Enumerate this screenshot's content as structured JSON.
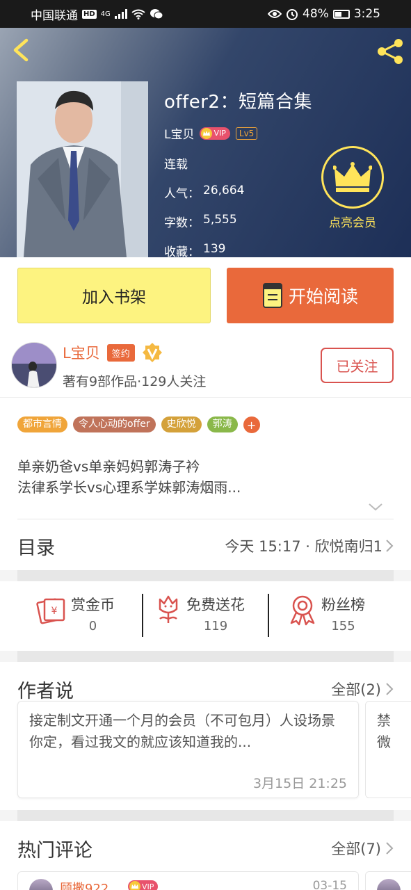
{
  "status_bar": {
    "carrier": "中国联通",
    "hd": "HD",
    "network": "4G",
    "battery": "48%",
    "time": "3:25"
  },
  "book": {
    "title": "offer2：短篇合集",
    "author": "L宝贝",
    "vip_label": "VIP",
    "level": "Lv5",
    "status": "连载",
    "stats": [
      {
        "label": "人气：",
        "value": "26,664"
      },
      {
        "label": "字数：",
        "value": "5,555"
      },
      {
        "label": "收藏：",
        "value": "139"
      }
    ],
    "member_label": "点亮会员"
  },
  "actions": {
    "add_shelf": "加入书架",
    "start_read": "开始阅读"
  },
  "author_card": {
    "name": "L宝贝",
    "sign_label": "签约",
    "summary": "著有9部作品·129人关注",
    "follow_label": "已关注"
  },
  "tags": [
    {
      "label": "都市言情",
      "color": "#f0a53a"
    },
    {
      "label": "令人心动的offer",
      "color": "#c0735a"
    },
    {
      "label": "史欣悦",
      "color": "#d4a13a"
    },
    {
      "label": "郭涛",
      "color": "#8ab84a"
    }
  ],
  "tag_more": "+",
  "intro": {
    "line1": "单亲奶爸vs单亲妈妈郭涛子衿",
    "line2": "法律系学长vs心理系学妹郭涛烟雨..."
  },
  "catalog": {
    "title": "目录",
    "latest": "今天 15:17 · 欣悦南归1"
  },
  "gifts": [
    {
      "label": "赏金币",
      "value": "0",
      "icon": "coin-icon"
    },
    {
      "label": "免费送花",
      "value": "119",
      "icon": "flower-icon"
    },
    {
      "label": "粉丝榜",
      "value": "155",
      "icon": "medal-icon"
    }
  ],
  "author_says": {
    "title": "作者说",
    "more": "全部(2)",
    "card_text": "接定制文开通一个月的会员（不可包月）人设场景你定，看过我文的就应该知道我的...",
    "card_time": "3月15日  21:25",
    "card2_text": "禁\n微"
  },
  "hot_comments": {
    "title": "热门评论",
    "more": "全部(7)",
    "first_name": "顾撒922",
    "first_vip": "VIP",
    "first_date": "03-15"
  },
  "colors": {
    "accent": "#e9693b",
    "shelf_button": "#fdf380",
    "member_gold": "#ffe45a",
    "follow_red": "#d9534f"
  }
}
